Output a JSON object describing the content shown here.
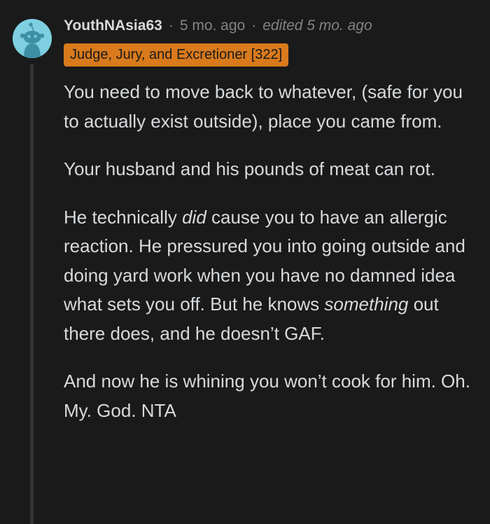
{
  "comment": {
    "username": "YouthNAsia63",
    "separator": "·",
    "time": "5 mo. ago",
    "edited": "edited 5 mo. ago",
    "flair": "Judge, Jury, and Excretioner [322]",
    "avatar_icon": "reddit-snoo-avatar-icon",
    "colors": {
      "background": "#1a1a1b",
      "text": "#d7dadc",
      "meta": "#818384",
      "flair_bg": "#d97a1c",
      "avatar_bg": "#7ecfe0"
    },
    "paragraphs": {
      "p1": "You need to move back to whatever, (safe for you to actually exist outside), place you came from.",
      "p2": "Your husband and his pounds of meat can rot.",
      "p3_a": "He technically ",
      "p3_em1": "did",
      "p3_b": " cause you to have an allergic reaction. He pressured you into going outside and doing yard work when you have no damned idea what sets you off. But he knows ",
      "p3_em2": "something",
      "p3_c": " out there does, and he doesn’t GAF.",
      "p4": "And now he is whining you won’t cook for him. Oh. My. God. NTA"
    }
  }
}
